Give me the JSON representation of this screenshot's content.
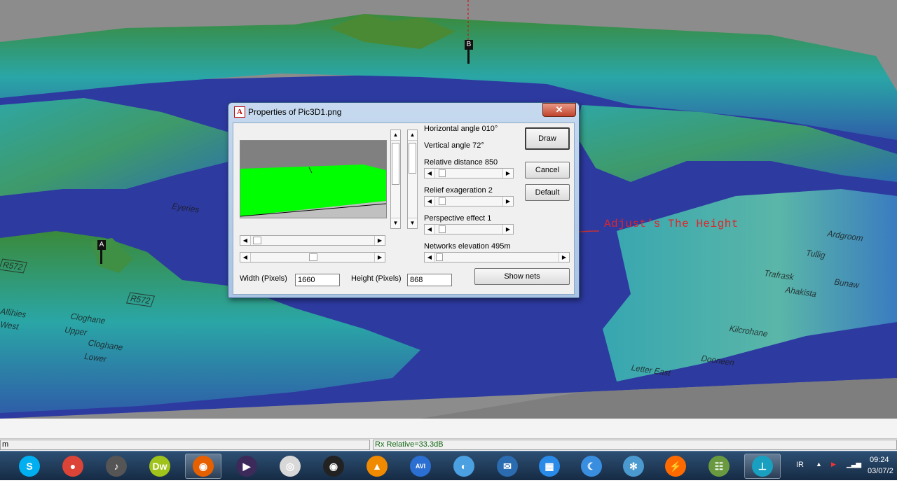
{
  "dialog": {
    "title": "Properties of Pic3D1.png",
    "close_label": "✕",
    "horizontal_angle": "Horizontal angle 010°",
    "vertical_angle": "Vertical angle 72°",
    "relative_distance": "Relative distance 850",
    "relief_exaggeration": "Relief exageration 2",
    "perspective_effect": "Perspective effect 1",
    "networks_elevation": "Networks elevation  495m",
    "draw_button": "Draw",
    "cancel_button": "Cancel",
    "default_button": "Default",
    "show_nets_button": "Show nets",
    "width_label": "Width (Pixels)",
    "width_value": "1660",
    "height_label": "Height (Pixels)",
    "height_value": "868",
    "preview_colors": {
      "sky": "#808080",
      "terrain": "#00ff00",
      "ground": "#c0c0c0"
    }
  },
  "annotation": "Adjust’s The Height",
  "map": {
    "marker_a": "A",
    "marker_b": "B",
    "labels": [
      "Allihies",
      "West",
      "Eyeries",
      "Cloghane",
      "Upper",
      "Cloghane",
      "Lower",
      "Kilcrohane",
      "Letter East",
      "Dooneen",
      "R572",
      "R572",
      "Ardgroom",
      "Tullig",
      "Trafrask",
      "Bunaw",
      "Ahakista"
    ]
  },
  "status": {
    "left": "m",
    "right": "Rx Relative=33.3dB"
  },
  "taskbar": {
    "apps": [
      {
        "name": "skype-icon",
        "glyph": "S",
        "color": "#00aff0"
      },
      {
        "name": "chrome-icon",
        "glyph": "●",
        "color": "#db4437"
      },
      {
        "name": "itunes-icon",
        "glyph": "♪",
        "color": "#555555"
      },
      {
        "name": "dreamweaver-icon",
        "glyph": "Dw",
        "color": "#9fc31a"
      },
      {
        "name": "firefox-icon",
        "glyph": "◉",
        "color": "#e66000"
      },
      {
        "name": "media-player-icon",
        "glyph": "▶",
        "color": "#3b2a5a"
      },
      {
        "name": "dvd-icon",
        "glyph": "◎",
        "color": "#d8d8d8"
      },
      {
        "name": "camera-icon",
        "glyph": "◉",
        "color": "#222222"
      },
      {
        "name": "vlc-icon",
        "glyph": "▲",
        "color": "#f08a00"
      },
      {
        "name": "avi-converter-icon",
        "glyph": "AVI",
        "color": "#2a6fd1"
      },
      {
        "name": "disc-burner-icon",
        "glyph": "◐",
        "color": "#4aa0e0"
      },
      {
        "name": "mail-icon",
        "glyph": "✉",
        "color": "#2b6cb0"
      },
      {
        "name": "calculator-icon",
        "glyph": "▦",
        "color": "#2a8ae8"
      },
      {
        "name": "moon-icon",
        "glyph": "☾",
        "color": "#3a8ee0"
      },
      {
        "name": "snowflake-icon",
        "glyph": "✻",
        "color": "#4a9ad0"
      },
      {
        "name": "flash-icon",
        "glyph": "⚡",
        "color": "#ff6a00"
      },
      {
        "name": "network-users-icon",
        "glyph": "☷",
        "color": "#6a9a40"
      },
      {
        "name": "radio-mobile-icon",
        "glyph": "⊥",
        "color": "#19a0c0"
      }
    ],
    "language": "IR",
    "time": "09:24",
    "date": "03/07/2"
  }
}
